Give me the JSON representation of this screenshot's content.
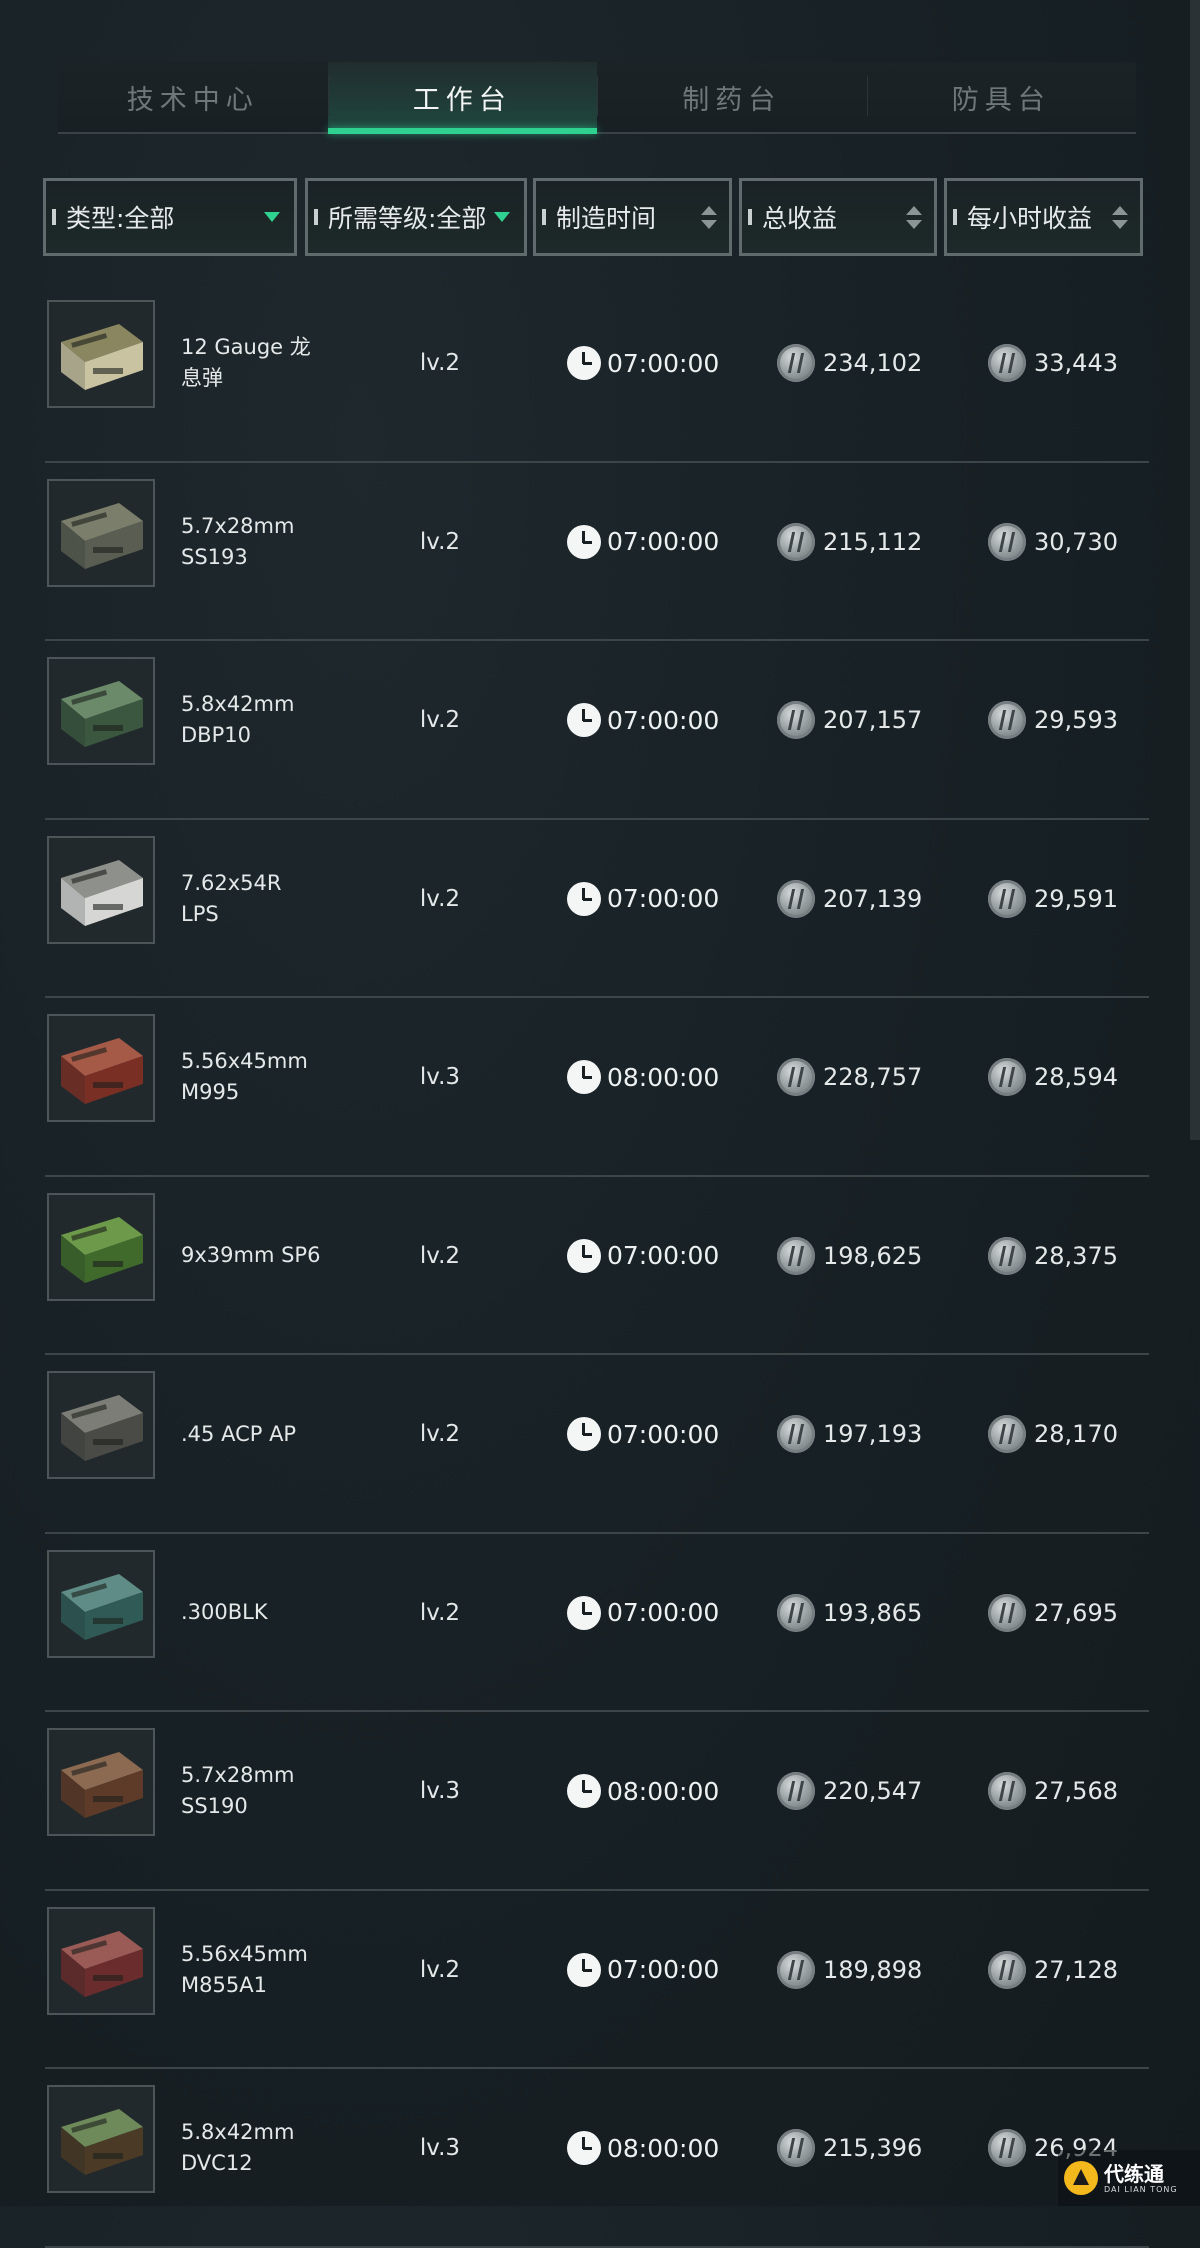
{
  "tabs": [
    {
      "label": "技术中心",
      "active": false
    },
    {
      "label": "工作台",
      "active": true
    },
    {
      "label": "制药台",
      "active": false
    },
    {
      "label": "防具台",
      "active": false
    }
  ],
  "filters": {
    "type": "类型:全部",
    "level": "所需等级:全部",
    "time": "制造时间",
    "total": "总收益",
    "hourly": "每小时收益"
  },
  "colors": {
    "accent": "#2ed18f",
    "background": "#182024",
    "border": "#5f6b6c"
  },
  "rows": [
    {
      "name1": "12 Gauge 龙",
      "name2": "息弹",
      "level": "lv.2",
      "time": "07:00:00",
      "total": "234,102",
      "hourly": "33,443",
      "box": "#c9c3a2",
      "stripe": "#8a8660"
    },
    {
      "name1": "5.7x28mm",
      "name2": "SS193",
      "level": "lv.2",
      "time": "07:00:00",
      "total": "215,112",
      "hourly": "30,730",
      "box": "#5a5e52",
      "stripe": "#7a7e6a"
    },
    {
      "name1": "5.8x42mm",
      "name2": "DBP10",
      "level": "lv.2",
      "time": "07:00:00",
      "total": "207,157",
      "hourly": "29,593",
      "box": "#3b5740",
      "stripe": "#6a8a6a"
    },
    {
      "name1": "7.62x54R",
      "name2": "LPS",
      "level": "lv.2",
      "time": "07:00:00",
      "total": "207,139",
      "hourly": "29,591",
      "box": "#d6d7d4",
      "stripe": "#8e908c"
    },
    {
      "name1": "5.56x45mm",
      "name2": "M995",
      "level": "lv.3",
      "time": "08:00:00",
      "total": "228,757",
      "hourly": "28,594",
      "box": "#7a2f25",
      "stripe": "#a55a48"
    },
    {
      "name1": "9x39mm SP6",
      "name2": "",
      "level": "lv.2",
      "time": "07:00:00",
      "total": "198,625",
      "hourly": "28,375",
      "box": "#3f6a2c",
      "stripe": "#6d9a4a"
    },
    {
      "name1": ".45 ACP AP",
      "name2": "",
      "level": "lv.2",
      "time": "07:00:00",
      "total": "197,193",
      "hourly": "28,170",
      "box": "#4a4b47",
      "stripe": "#7c7d76"
    },
    {
      "name1": ".300BLK",
      "name2": "",
      "level": "lv.2",
      "time": "07:00:00",
      "total": "193,865",
      "hourly": "27,695",
      "box": "#2f5a56",
      "stripe": "#5f8c86"
    },
    {
      "name1": "5.7x28mm",
      "name2": "SS190",
      "level": "lv.3",
      "time": "08:00:00",
      "total": "220,547",
      "hourly": "27,568",
      "box": "#5e3a28",
      "stripe": "#8c6a52"
    },
    {
      "name1": "5.56x45mm",
      "name2": "M855A1",
      "level": "lv.2",
      "time": "07:00:00",
      "total": "189,898",
      "hourly": "27,128",
      "box": "#6a2c2c",
      "stripe": "#9a5a56"
    },
    {
      "name1": "5.8x42mm",
      "name2": "DVC12",
      "level": "lv.3",
      "time": "08:00:00",
      "total": "215,396",
      "hourly": "26,924",
      "box": "#4a3a26",
      "stripe": "#6e8a5a"
    }
  ],
  "watermark": {
    "big": "代练通",
    "small": "DAI LIAN TONG"
  }
}
